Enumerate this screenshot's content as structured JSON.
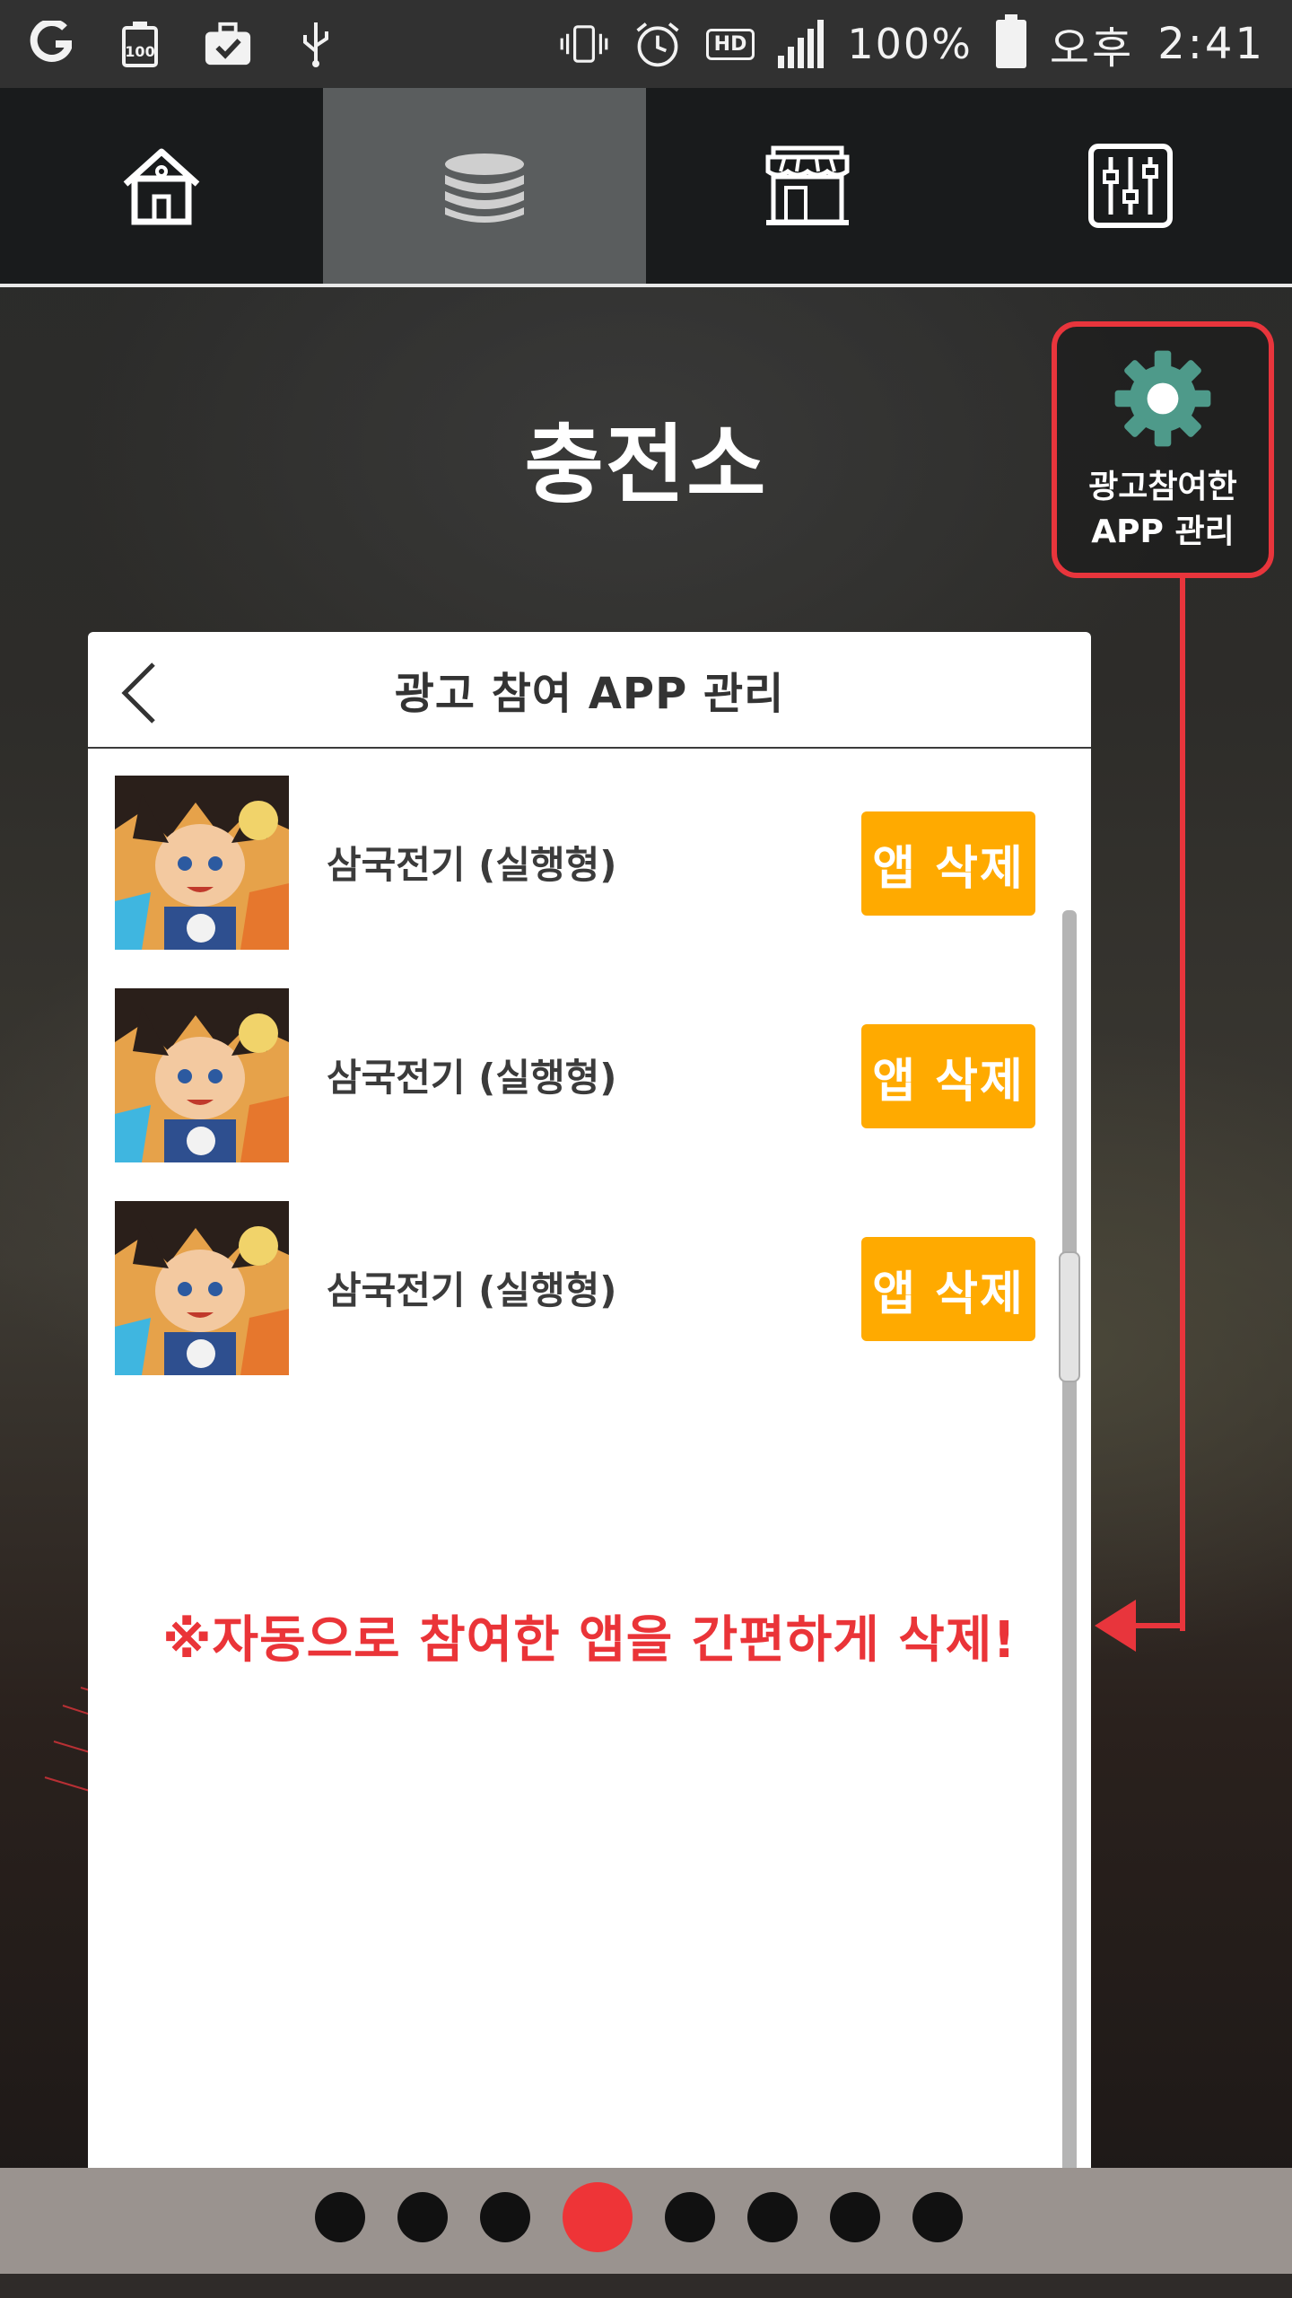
{
  "status_bar": {
    "battery_text": "100%",
    "ampm": "오후",
    "time": "2:41",
    "hd_label": "HD",
    "left_icons": [
      "g-logo-icon",
      "battery-100-icon",
      "briefcase-check-icon",
      "usb-icon"
    ],
    "right_icons": [
      "vibrate-icon",
      "alarm-icon",
      "hd-voice-icon",
      "signal-icon",
      "battery-icon"
    ]
  },
  "tabs": [
    {
      "icon": "home-icon",
      "active": false
    },
    {
      "icon": "coins-icon",
      "active": true
    },
    {
      "icon": "store-icon",
      "active": false
    },
    {
      "icon": "sliders-icon",
      "active": false
    }
  ],
  "page": {
    "title": "충전소"
  },
  "callout": {
    "icon": "gear-icon",
    "line1": "광고참여한",
    "line2": "APP 관리",
    "color": "#e8353c"
  },
  "card": {
    "title": "광고 참여 APP 관리",
    "back_icon": "chevron-left-icon",
    "apps": [
      {
        "name": "삼국전기 (실행형)",
        "button": "앱 삭제"
      },
      {
        "name": "삼국전기 (실행형)",
        "button": "앱 삭제"
      },
      {
        "name": "삼국전기 (실행형)",
        "button": "앱 삭제"
      }
    ],
    "notice": "※자동으로 참여한 앱을 간편하게 삭제!"
  },
  "pager": {
    "count": 8,
    "active_index": 3
  },
  "colors": {
    "accent_orange": "#ffaa00",
    "accent_red": "#e8353c",
    "gear_teal": "#4e9a8a"
  }
}
